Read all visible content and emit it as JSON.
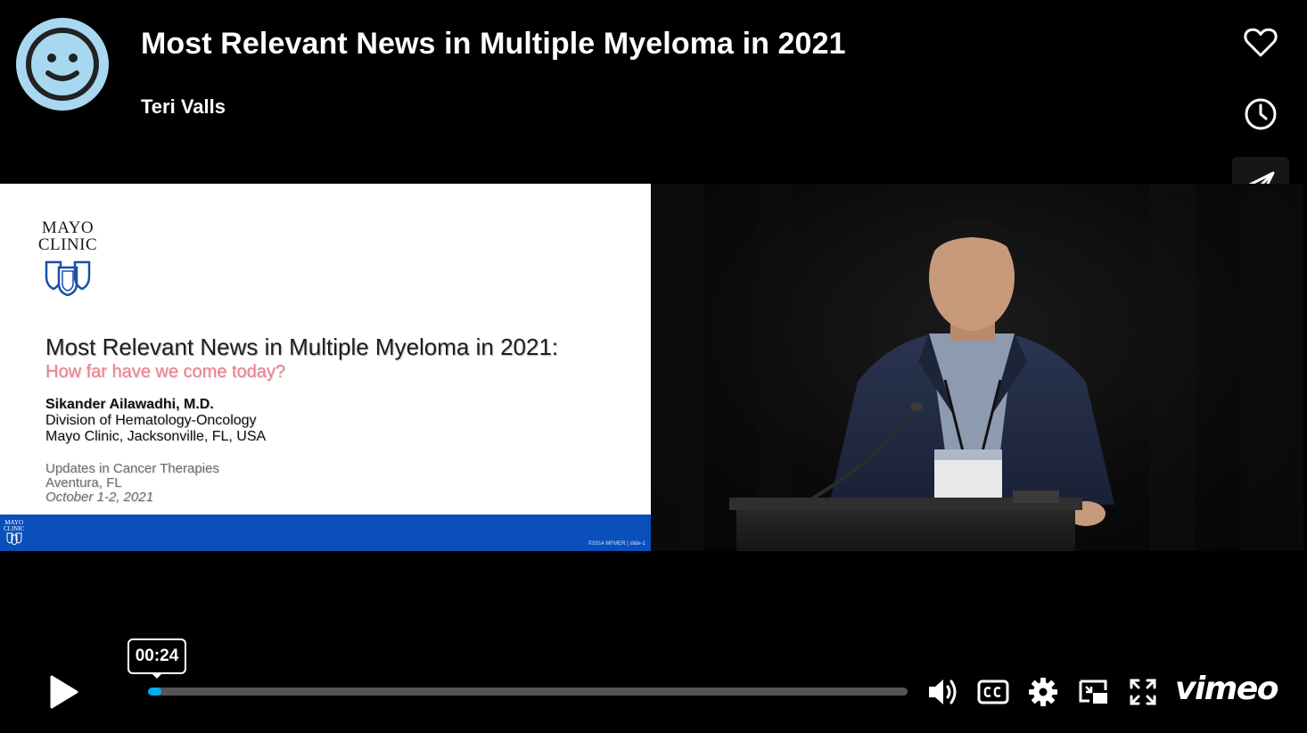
{
  "header": {
    "title": "Most Relevant News in Multiple Myeloma in 2021",
    "author": "Teri Valls"
  },
  "side_buttons": {
    "like_icon": "heart-icon",
    "watch_later_icon": "clock-icon",
    "share_icon": "paper-plane-icon"
  },
  "slide": {
    "logo_line1": "MAYO",
    "logo_line2": "CLINIC",
    "title": "Most Relevant News in Multiple Myeloma in 2021:",
    "subtitle": "How far have we come today?",
    "presenter": "Sikander Ailawadhi, M.D.",
    "division": "Division of Hematology-Oncology",
    "institution": "Mayo Clinic, Jacksonville, FL, USA",
    "event": "Updates in Cancer Therapies",
    "location": "Aventura, FL",
    "dates": "October 1-2, 2021",
    "footer_logo1": "MAYO",
    "footer_logo2": "CLINIC",
    "footer_copyright": "©2014 MFMER | slide-1"
  },
  "player": {
    "timecode": "00:24",
    "progress_fraction": 0.018,
    "progress_color": "#00adef",
    "brand": "vimeo",
    "icons": [
      "play-icon",
      "volume-icon",
      "closed-captions-icon",
      "settings-icon",
      "picture-in-picture-icon",
      "fullscreen-icon"
    ]
  },
  "colors": {
    "avatar_bg": "#a8d8f0",
    "slide_footer": "#0a4fba",
    "slide_subtitle": "#f07b8a"
  }
}
